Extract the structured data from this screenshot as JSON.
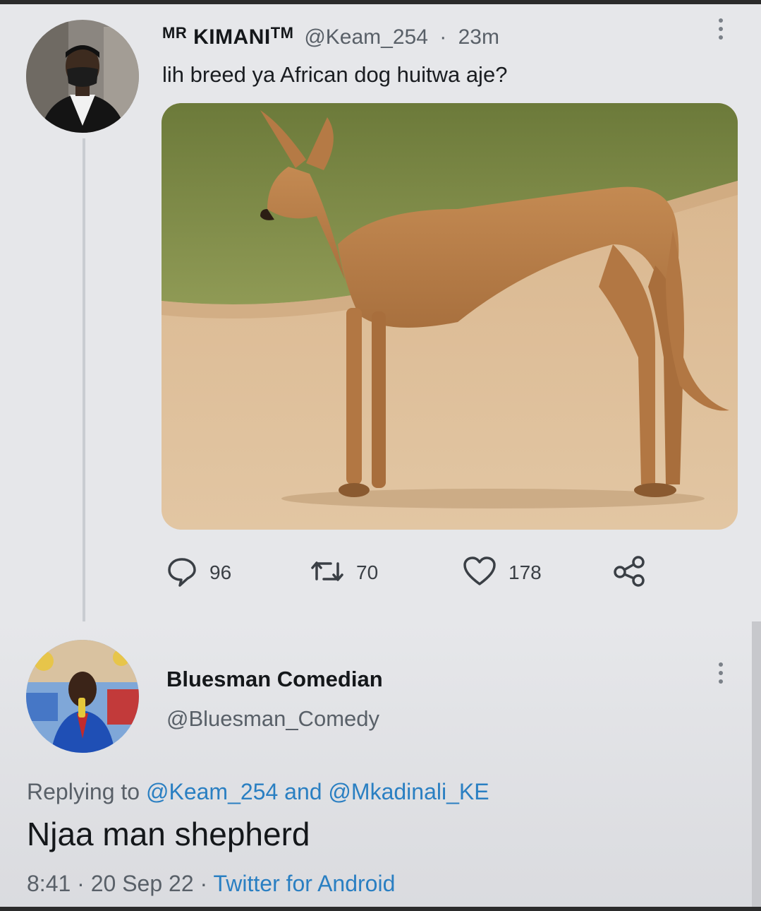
{
  "tweet": {
    "display_name_prefix": "MR",
    "display_name": "KIMANI",
    "tm": "TM",
    "handle": "@Keam_254",
    "separator": "·",
    "time": "23m",
    "text": "lih breed ya African dog huitwa aje?",
    "image_subject": "tan-african-dog-photo",
    "stats": {
      "replies": "96",
      "retweets": "70",
      "likes": "178"
    }
  },
  "reply": {
    "display_name": "Bluesman Comedian",
    "handle": "@Bluesman_Comedy",
    "replying_prefix": "Replying to",
    "mention_1": "@Keam_254",
    "and_word": "and",
    "mention_2": "@Mkadinali_KE",
    "text": "Njaa man shepherd",
    "time": "8:41",
    "separator": "·",
    "date": "20 Sep 22",
    "source": "Twitter for Android"
  },
  "icons": [
    "reply-icon",
    "retweet-icon",
    "like-icon",
    "share-icon",
    "more-icon"
  ],
  "colors": {
    "background": "#e6e7ea",
    "link": "#2a7fc2",
    "secondary_text": "#596068"
  }
}
